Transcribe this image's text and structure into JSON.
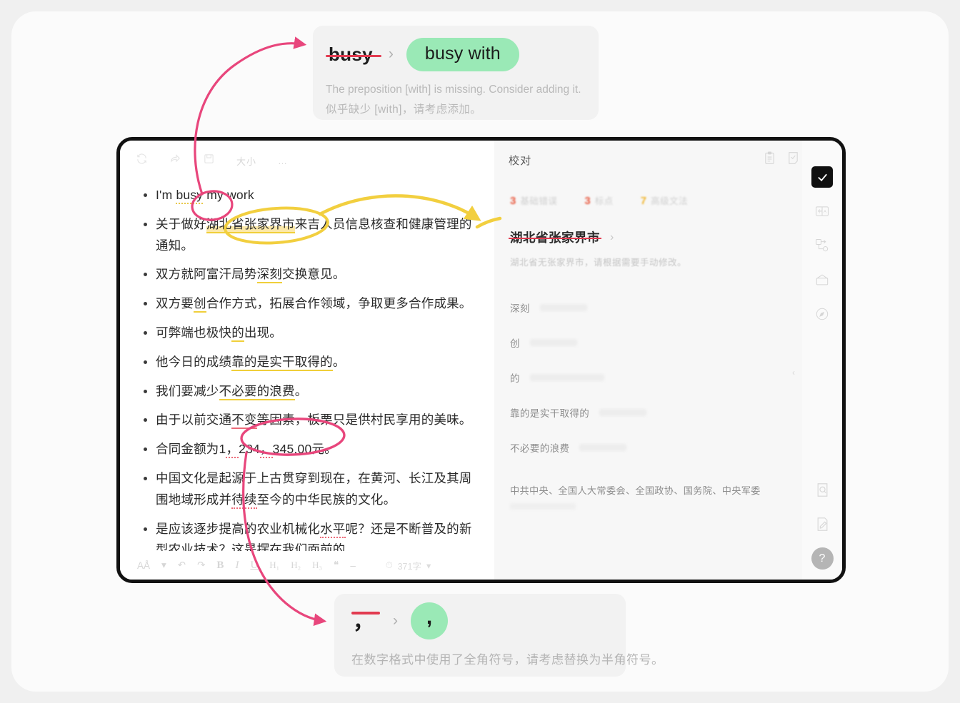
{
  "top_suggestion_card": {
    "original": "busy",
    "arrow": "›",
    "replacement": "busy with",
    "desc_en": "The preposition [with] is missing. Consider adding it.",
    "desc_zh": "似乎缺少 [with]，请考虑添加。"
  },
  "bottom_suggestion_card": {
    "original": "，",
    "arrow": "›",
    "replacement": ",",
    "desc": "在数字格式中使用了全角符号，请考虑替换为半角符号。"
  },
  "editor": {
    "top_toolbar": [
      {
        "name": "sync-icon",
        "label": "↻"
      },
      {
        "name": "share-icon",
        "label": "↪"
      },
      {
        "name": "save-icon",
        "label": "▤"
      },
      {
        "name": "font-size-icon",
        "label": "大小"
      },
      {
        "name": "more-icon",
        "label": "…"
      }
    ],
    "bullets": [
      {
        "segments": [
          {
            "text": "I'm ",
            "mark": "none"
          },
          {
            "text": "busy",
            "mark": "yellow-dotted"
          },
          {
            "text": " my work",
            "mark": "none"
          }
        ],
        "lang": "en"
      },
      {
        "segments": [
          {
            "text": "关于做好",
            "mark": "none"
          },
          {
            "text": "湖北省张家界市",
            "mark": "highlight-yellow"
          },
          {
            "text": "来吉人员信息核查和健康管理的通知。",
            "mark": "none"
          }
        ],
        "lang": "zh"
      },
      {
        "segments": [
          {
            "text": "双方就阿富汗局势",
            "mark": "none"
          },
          {
            "text": "深刻",
            "mark": "yellow"
          },
          {
            "text": "交换意见。",
            "mark": "none"
          }
        ],
        "lang": "zh"
      },
      {
        "segments": [
          {
            "text": "双方要",
            "mark": "none"
          },
          {
            "text": "创",
            "mark": "yellow"
          },
          {
            "text": "合作方式，拓展合作领域，争取更多合作成果。",
            "mark": "none"
          }
        ],
        "lang": "zh"
      },
      {
        "segments": [
          {
            "text": "可弊端也极快",
            "mark": "none"
          },
          {
            "text": "的",
            "mark": "yellow"
          },
          {
            "text": "出现。",
            "mark": "none"
          }
        ],
        "lang": "zh"
      },
      {
        "segments": [
          {
            "text": "他今日的成绩",
            "mark": "none"
          },
          {
            "text": "靠的是实干取得的",
            "mark": "yellow"
          },
          {
            "text": "。",
            "mark": "none"
          }
        ],
        "lang": "zh"
      },
      {
        "segments": [
          {
            "text": "我们要减少",
            "mark": "none"
          },
          {
            "text": "不必要的浪费",
            "mark": "yellow"
          },
          {
            "text": "。",
            "mark": "none"
          }
        ],
        "lang": "zh"
      },
      {
        "segments": [
          {
            "text": "由于以前交通",
            "mark": "none"
          },
          {
            "text": "不变",
            "mark": "red"
          },
          {
            "text": "等因素，板栗只是供村民享用的美味。",
            "mark": "none"
          }
        ],
        "lang": "zh"
      },
      {
        "segments": [
          {
            "text": "合同金额为1",
            "mark": "none"
          },
          {
            "text": "，",
            "mark": "red-dotted"
          },
          {
            "text": "234",
            "mark": "none"
          },
          {
            "text": "，",
            "mark": "red-dotted"
          },
          {
            "text": "345.00元。",
            "mark": "none"
          }
        ],
        "lang": "zh"
      },
      {
        "segments": [
          {
            "text": "中国文化是起源于上古贯穿到现在，在黄河、长江及其周围地域形成并",
            "mark": "none"
          },
          {
            "text": "待续",
            "mark": "red-dotted"
          },
          {
            "text": "至今的中华民族的文化。",
            "mark": "none"
          }
        ],
        "lang": "zh"
      },
      {
        "segments": [
          {
            "text": "是应该逐步提高的农业机械化",
            "mark": "none"
          },
          {
            "text": "水平",
            "mark": "red-dotted"
          },
          {
            "text": "呢？还是不断普及的新型农业技术？这是摆在我们面前的",
            "mark": "none"
          }
        ],
        "lang": "zh"
      }
    ],
    "bottom_toolbar": {
      "font_size_label": "AÅ",
      "dropdown": "▾",
      "undo": "↶",
      "redo": "↷",
      "bold": "B",
      "italic": "I",
      "underline": "U",
      "h1": "H₁",
      "h2": "H₂",
      "h3": "H₃",
      "quote": "❝",
      "divider": "–",
      "timer_icon": "⏱",
      "word_count": "371字",
      "word_count_caret": "▾"
    }
  },
  "proof_panel": {
    "title": "校对",
    "head_icons": [
      {
        "name": "clipboard-icon",
        "glyph": "Ὄb"
      },
      {
        "name": "checked-doc-icon",
        "glyph": "☑"
      }
    ],
    "stats": [
      {
        "count": "3",
        "label": "基础错误",
        "color": "#e8593f"
      },
      {
        "count": "3",
        "label": "标点",
        "color": "#e8593f"
      },
      {
        "count": "7",
        "label": "高级文法",
        "color": "#f0b429"
      }
    ],
    "active_issue": {
      "word": "湖北省张家界市",
      "chevron": "›",
      "desc": "湖北省无张家界市，请根据需要手动修改。"
    },
    "issues": [
      {
        "text": "深刻",
        "wide": false
      },
      {
        "text": "创",
        "wide": false
      },
      {
        "text": "的",
        "wide": true
      },
      {
        "text": "靠的是实干取得的",
        "wide": false
      },
      {
        "text": "不必要的浪费",
        "wide": false
      }
    ],
    "last_issue": "中共中央、全国人大常委会、全国政协、国务院、中央军委",
    "collapse_caret": "‹"
  },
  "right_rail": {
    "items": [
      {
        "name": "proofread-icon",
        "glyph": "✔",
        "active": true
      },
      {
        "name": "translate-icon",
        "glyph": "中|A",
        "active": false
      },
      {
        "name": "rewrite-icon",
        "glyph": "⇄",
        "active": false
      },
      {
        "name": "envelope-icon",
        "glyph": "✉",
        "active": false
      },
      {
        "name": "compass-icon",
        "glyph": "◎",
        "active": false
      },
      {
        "name": "doc-search-icon",
        "glyph": "⌕",
        "active": false
      },
      {
        "name": "doc-edit-icon",
        "glyph": "✎",
        "active": false
      }
    ],
    "help_label": "?"
  },
  "annotations": {
    "pink_color": "#e8467c",
    "yellow_color": "#f2cf3f",
    "circle_busy": "busy",
    "circle_comma": "， ，",
    "ellipse_city": "湖北省张家界市"
  }
}
